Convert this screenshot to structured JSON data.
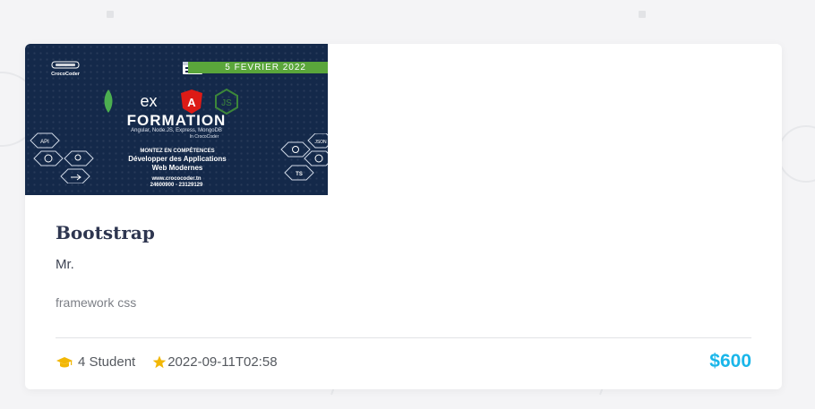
{
  "course": {
    "title": "Bootstrap",
    "teacher": "Mr.",
    "description": "framework css",
    "students": "4 Student",
    "date": "2022-09-11T02:58",
    "price": "$600",
    "accent_color": "#1ab6e9",
    "icon_color": "#f2b705",
    "icons": [
      "graduation-cap-icon",
      "star-icon"
    ]
  },
  "banner": {
    "brand": "CrocoCoder",
    "date": "5 FEVRIER 2022",
    "title": "FORMATION",
    "subtitle": "Angular, Node.JS, Express, MongoDB",
    "subtitle2": "In CrocoCoder",
    "heading": "MONTEZ EN COMPÉTENCES",
    "heading2": "Développer des Applications",
    "heading3": "Web Modernes",
    "website": "www.crococoder.tn",
    "phones": "24600900 - 23129129",
    "badges": [
      "API",
      "JSON",
      "TS"
    ],
    "colors": {
      "background": "#14294a",
      "date_bar": "#5aa63b",
      "angular": "#dd1b16",
      "mongodb": "#4caf50",
      "node": "#3c873a"
    }
  }
}
